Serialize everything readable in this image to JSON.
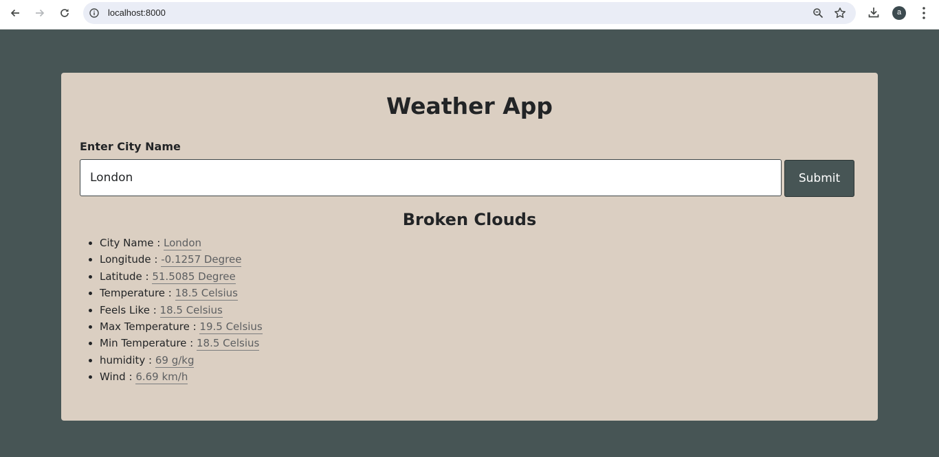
{
  "browser": {
    "url": "localhost:8000",
    "avatar_letter": "a"
  },
  "app": {
    "title": "Weather App",
    "input_label": "Enter City Name",
    "input_value": "London",
    "submit_label": "Submit",
    "condition": "Broken Clouds"
  },
  "details": [
    {
      "label": "City Name :",
      "value": "London"
    },
    {
      "label": "Longitude :",
      "value": "-0.1257 Degree"
    },
    {
      "label": "Latitude :",
      "value": "51.5085 Degree"
    },
    {
      "label": "Temperature :",
      "value": "18.5 Celsius"
    },
    {
      "label": "Feels Like :",
      "value": "18.5 Celsius"
    },
    {
      "label": "Max Temperature :",
      "value": "19.5 Celsius"
    },
    {
      "label": "Min Temperature :",
      "value": "18.5 Celsius"
    },
    {
      "label": "humidity :",
      "value": "69 g/kg"
    },
    {
      "label": "Wind :",
      "value": "6.69 km/h"
    }
  ],
  "colors": {
    "page_background": "#475555",
    "card_background": "#dbcfc2",
    "button_background": "#475555"
  }
}
